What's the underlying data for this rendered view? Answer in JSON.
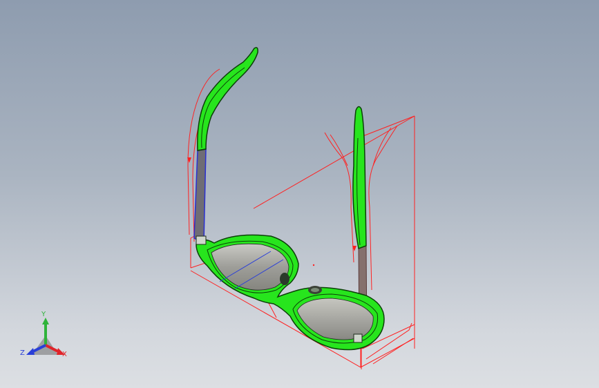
{
  "viewport": {
    "background_top": "#8e9caf",
    "background_bottom": "#dcdfe3"
  },
  "model": {
    "part": "sunglasses",
    "highlight_color": "#22e01a",
    "sketch_color": "#ff2020",
    "lens_color": "#9a9a96",
    "temple_color": "#7d7a79"
  },
  "triad": {
    "x_label": "X",
    "y_label": "Y",
    "z_label": "Z",
    "x_color": "#e0242a",
    "y_color": "#2fb33a",
    "z_color": "#2a3fd8"
  }
}
